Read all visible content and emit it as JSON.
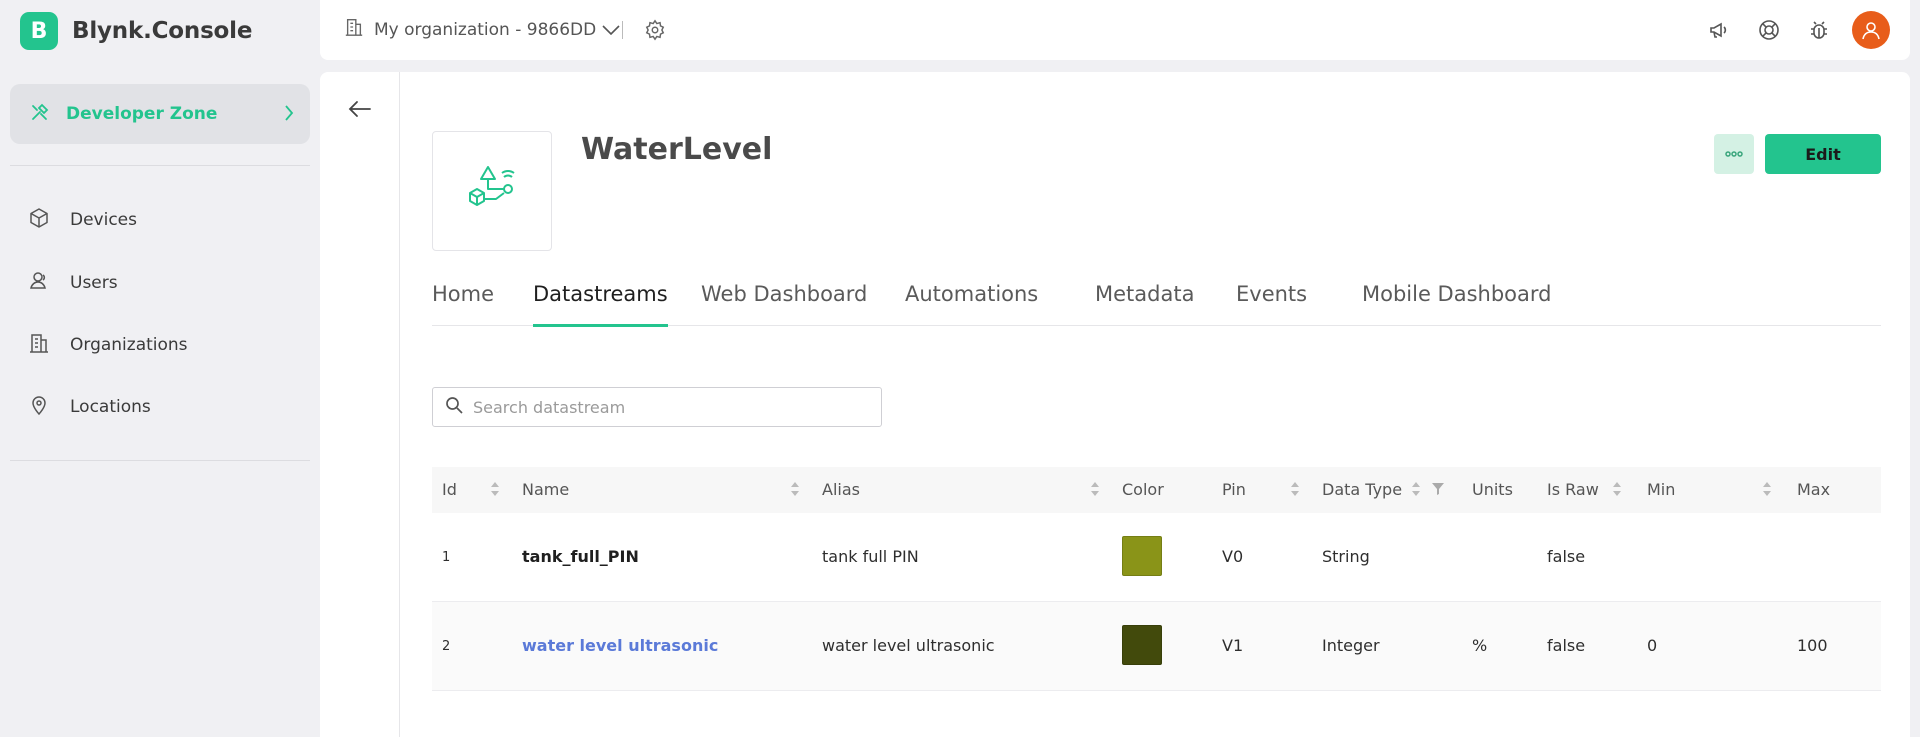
{
  "app": {
    "logo_letter": "B",
    "name": "Blynk.Console"
  },
  "sidebar": {
    "developer_zone": "Developer Zone",
    "items": [
      {
        "label": "Devices",
        "icon": "cube-icon"
      },
      {
        "label": "Users",
        "icon": "users-icon"
      },
      {
        "label": "Organizations",
        "icon": "building-icon"
      },
      {
        "label": "Locations",
        "icon": "location-pin-icon"
      }
    ]
  },
  "topbar": {
    "organization": "My organization - 9866DD"
  },
  "template": {
    "title": "WaterLevel",
    "edit_label": "Edit"
  },
  "tabs": [
    "Home",
    "Datastreams",
    "Web Dashboard",
    "Automations",
    "Metadata",
    "Events",
    "Mobile Dashboard"
  ],
  "active_tab": "Datastreams",
  "search": {
    "placeholder": "Search datastream",
    "value": ""
  },
  "table": {
    "columns": [
      "Id",
      "Name",
      "Alias",
      "Color",
      "Pin",
      "Data Type",
      "Units",
      "Is Raw",
      "Min",
      "Max"
    ],
    "rows": [
      {
        "id": "1",
        "name": "tank_full_PIN",
        "alias": "tank full PIN",
        "color": "#8a9418",
        "pin": "V0",
        "data_type": "String",
        "units": "",
        "is_raw": "false",
        "min": "",
        "max": ""
      },
      {
        "id": "2",
        "name": "water level ultrasonic",
        "alias": "water level ultrasonic",
        "color": "#424a0c",
        "pin": "V1",
        "data_type": "Integer",
        "units": "%",
        "is_raw": "false",
        "min": "0",
        "max": "100"
      }
    ]
  },
  "colors": {
    "brand": "#23c48e",
    "link": "#5b7ad8",
    "avatar": "#e85d1a"
  }
}
